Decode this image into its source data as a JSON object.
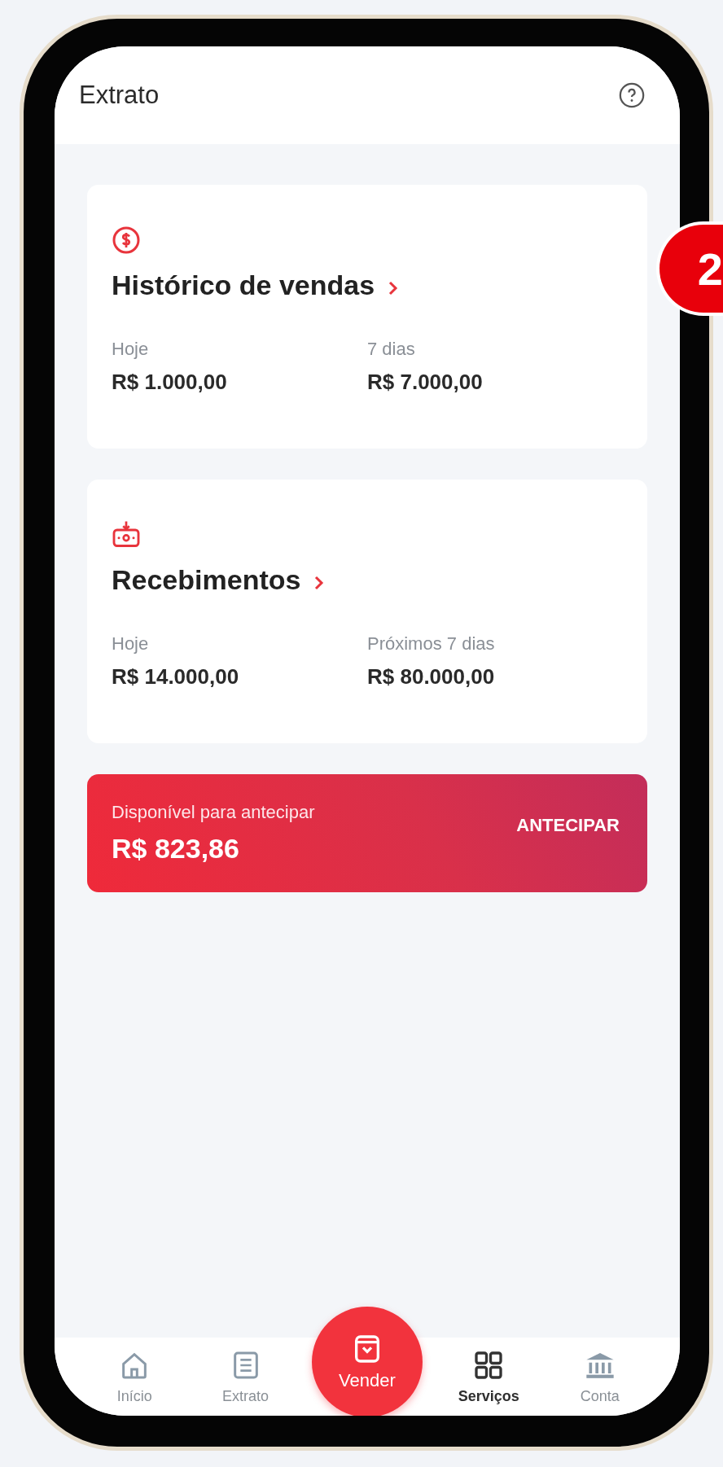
{
  "header": {
    "title": "Extrato"
  },
  "cards": [
    {
      "kind": "sales",
      "title": "Histórico de vendas",
      "stats": [
        {
          "label": "Hoje",
          "value": "R$ 1.000,00"
        },
        {
          "label": "7 dias",
          "value": "R$ 7.000,00"
        }
      ]
    },
    {
      "kind": "receipts",
      "title": "Recebimentos",
      "stats": [
        {
          "label": "Hoje",
          "value": "R$ 14.000,00"
        },
        {
          "label": "Próximos 7 dias",
          "value": "R$ 80.000,00"
        }
      ]
    }
  ],
  "advance": {
    "label": "Disponível para antecipar",
    "amount": "R$ 823,86",
    "action": "ANTECIPAR"
  },
  "nav": [
    {
      "kind": "home",
      "label": "Início",
      "selected": false
    },
    {
      "kind": "statement",
      "label": "Extrato",
      "selected": false
    },
    {
      "kind": "sell",
      "label": "Vender",
      "selected": false
    },
    {
      "kind": "services",
      "label": "Serviços",
      "selected": true
    },
    {
      "kind": "account",
      "label": "Conta",
      "selected": false
    }
  ],
  "callout": {
    "label": "2"
  }
}
